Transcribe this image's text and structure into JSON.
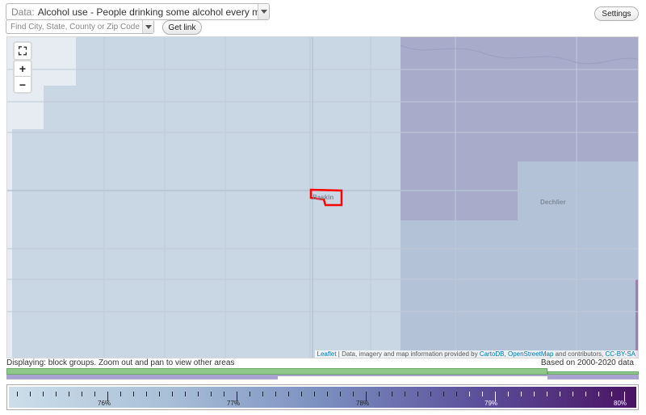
{
  "controls": {
    "data_prefix": "Data:",
    "data_value": "Alcohol use - People drinking some alcohol every month (%)",
    "search_placeholder": "Find City, State, County or Zip Code",
    "get_link_label": "Get link",
    "settings_label": "Settings"
  },
  "map": {
    "zoom_in": "+",
    "zoom_out": "−",
    "zoom_extent_icon": "fullscreen-icon",
    "places": [
      "Baskin",
      "Dechlier"
    ],
    "highlight_color": "#ff0000",
    "attribution": {
      "leaflet": "Leaflet",
      "text": " | Data, imagery and map information provided by ",
      "cartodb": "CartoDB",
      "sep": ", ",
      "osm": "OpenStreetMap",
      "tail": " and contributors, ",
      "license": "CC-BY-SA"
    }
  },
  "status": {
    "displaying": "Displaying: block groups. Zoom out and pan to view other areas",
    "based_on": "Based on 2000-2020 data"
  },
  "legend": {
    "labels": [
      "76%",
      "77%",
      "78%",
      "79%",
      "80%"
    ],
    "colors": [
      "#ccdee9",
      "#a9c0d8",
      "#7b8fbf",
      "#5b4f9a",
      "#4a1262"
    ]
  }
}
